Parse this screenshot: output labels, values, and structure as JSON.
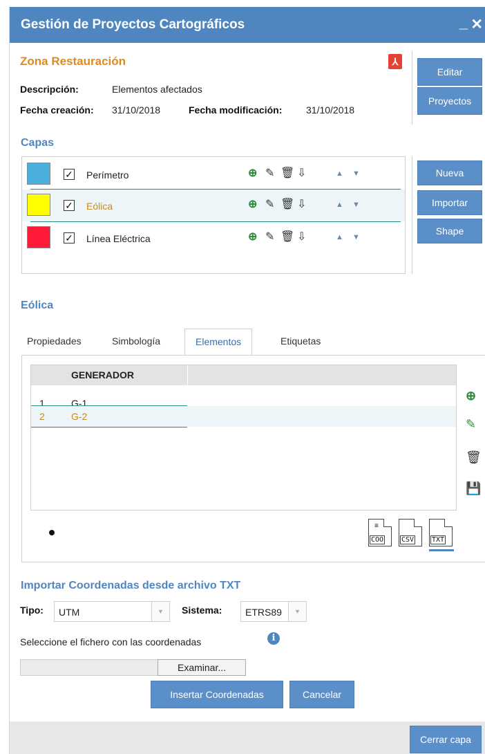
{
  "window": {
    "title": "Gestión de Proyectos Cartográficos",
    "minimize_label": "_",
    "close_label": "✕"
  },
  "project": {
    "name": "Zona Restauración",
    "description_label": "Descripción:",
    "description_value": "Elementos afectados",
    "created_label": "Fecha creación:",
    "created_value": "31/10/2018",
    "modified_label": "Fecha modificación:",
    "modified_value": "31/10/2018",
    "pdf_glyph": "⅄"
  },
  "top_buttons": {
    "edit": "Editar",
    "projects": "Proyectos"
  },
  "layers": {
    "title": "Capas",
    "items": [
      {
        "name": "Perímetro",
        "color": "#4aaedc",
        "checked": "✓"
      },
      {
        "name": "Eólica",
        "color": "#ffff00",
        "checked": "✓"
      },
      {
        "name": "Línea Eléctrica",
        "color": "#ff1a3a",
        "checked": "✓"
      }
    ],
    "row_icons": {
      "zoom": "⊕",
      "edit": "✎",
      "delete": "🗑",
      "export": "⇩",
      "up": "▲",
      "down": "▼"
    }
  },
  "layer_buttons": {
    "new": "Nueva",
    "import": "Importar",
    "shape": "Shape"
  },
  "selected_layer": {
    "title": "Eólica",
    "tabs": [
      "Propiedades",
      "Simbología",
      "Elementos",
      "Etiquetas"
    ],
    "active_tab": "Elementos"
  },
  "elements_grid": {
    "column_header": "GENERADOR",
    "rows": [
      {
        "num": "1",
        "value": "G-1"
      },
      {
        "num": "2",
        "value": "G-2"
      }
    ],
    "side_icons": {
      "zoom": "⊕",
      "edit": "✎",
      "delete": "🗑",
      "save": "💾"
    },
    "pager_dot": "•",
    "file_buttons": [
      {
        "ext": "COO",
        "lines": "≡"
      },
      {
        "ext": "CSV",
        "lines": ""
      },
      {
        "ext": "TXT",
        "lines": ""
      }
    ]
  },
  "import_form": {
    "title": "Importar Coordenadas desde archivo TXT",
    "type_label": "Tipo:",
    "type_value": "UTM",
    "system_label": "Sistema:",
    "system_value": "ETRS89",
    "select_arrow": "▼",
    "file_prompt": "Seleccione el fichero con las coordenadas",
    "info_glyph": "i",
    "browse_label": "Examinar...",
    "insert_button": "Insertar Coordenadas",
    "cancel_button": "Cancelar"
  },
  "footer": {
    "close_layer_button": "Cerrar capa"
  },
  "colors": {
    "accent": "#4f86c0",
    "button": "#5b8fc9",
    "selected_text": "#c98a20",
    "project_title": "#e08a1e",
    "row_separator": "#2c8a86"
  }
}
